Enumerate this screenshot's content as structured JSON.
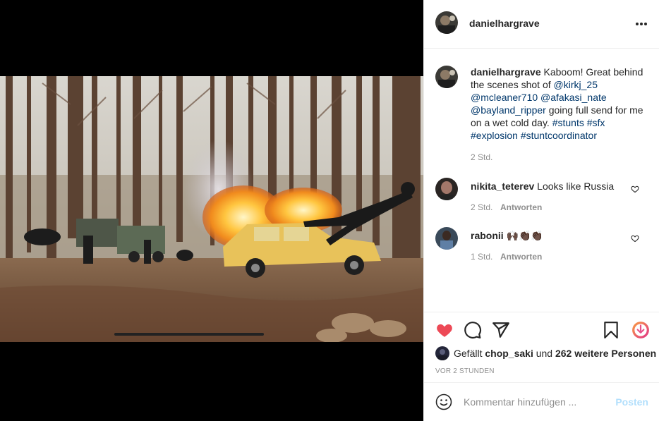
{
  "post": {
    "username": "danielhargrave",
    "caption_prefix": "Kaboom! Great behind the scenes shot of ",
    "mention1": "@kirkj_25",
    "mention2": "@mcleaner710",
    "mention3": "@afakasi_nate",
    "mention4": "@bayland_ripper",
    "caption_mid": " going full send for me on a wet cold day. ",
    "tag1": "#stunts",
    "tag2": "#sfx",
    "tag3": "#explosion",
    "tag4": "#stuntcoordinator",
    "caption_time": "2 Std."
  },
  "comments": [
    {
      "username": "nikita_teterev",
      "text": "Looks like Russia",
      "time": "2 Std.",
      "reply": "Antworten"
    },
    {
      "username": "rabonii",
      "text": "🙌🏿👏🏿👏🏿",
      "time": "1 Std.",
      "reply": "Antworten"
    }
  ],
  "likes": {
    "prefix": "Gefällt ",
    "user": "chop_saki",
    "middle": " und ",
    "count": "262 weitere Personen"
  },
  "date": "VOR 2 STUNDEN",
  "comment_box": {
    "placeholder": "Kommentar hinzufügen ...",
    "post_label": "Posten"
  },
  "colors": {
    "liked_heart": "#ed4956",
    "link": "#00376b",
    "post_disabled": "#b2dffc"
  },
  "icons": [
    "more-icon",
    "heart-filled-icon",
    "comment-icon",
    "share-icon",
    "bookmark-icon",
    "download-icon",
    "emoji-icon",
    "heart-outline-icon"
  ]
}
